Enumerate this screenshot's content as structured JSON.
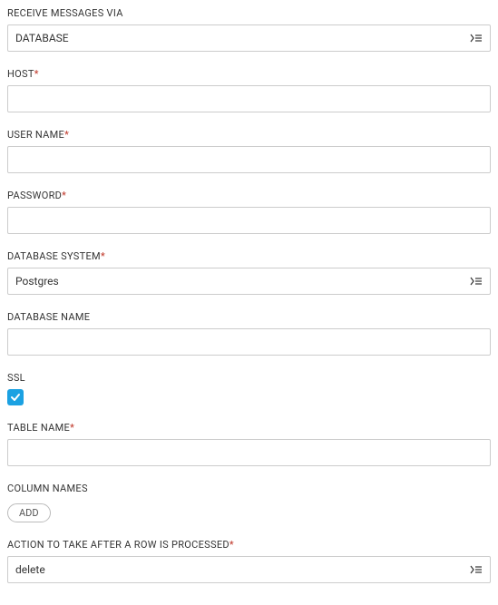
{
  "receive_via": {
    "label": "RECEIVE MESSAGES VIA",
    "value": "DATABASE"
  },
  "host": {
    "label": "HOST",
    "required": "*",
    "value": ""
  },
  "username": {
    "label": "USER NAME",
    "required": "*",
    "value": ""
  },
  "password": {
    "label": "PASSWORD",
    "required": "*",
    "value": ""
  },
  "db_system": {
    "label": "DATABASE SYSTEM",
    "required": "*",
    "value": "Postgres"
  },
  "db_name": {
    "label": "DATABASE NAME",
    "value": ""
  },
  "ssl": {
    "label": "SSL",
    "checked": true
  },
  "table_name": {
    "label": "TABLE NAME",
    "required": "*",
    "value": ""
  },
  "column_names": {
    "label": "COLUMN NAMES",
    "add_label": "ADD"
  },
  "action": {
    "label": "ACTION TO TAKE AFTER A ROW IS PROCESSED",
    "required": "*",
    "value": "delete"
  }
}
